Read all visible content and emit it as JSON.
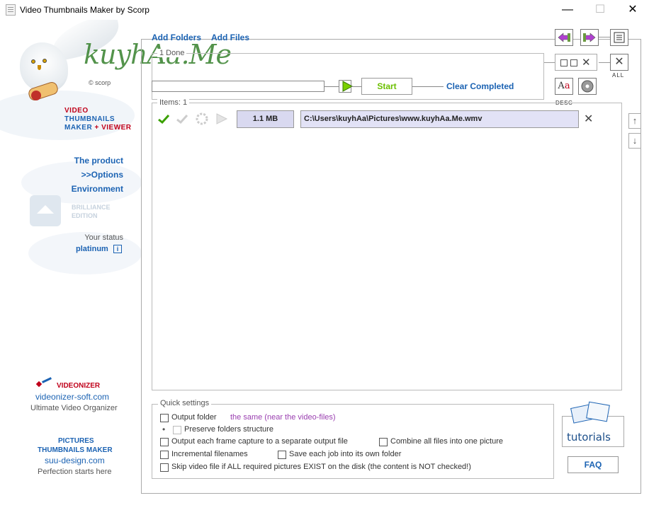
{
  "window": {
    "title": "Video Thumbnails Maker by Scorp",
    "minimize_glyph": "—",
    "maximize_glyph": "☐",
    "close_glyph": "✕"
  },
  "sidebar": {
    "scorp_label": "© scorp",
    "brand_video": "VIDEO",
    "brand_thumbnails": "THUMBNAILS",
    "brand_maker": "MAKER",
    "brand_plus": "+",
    "brand_viewer": "VIEWER",
    "nav": [
      {
        "label": "The product"
      },
      {
        "label": ">>Options"
      },
      {
        "label": "Environment"
      }
    ],
    "edition_line1": "BRILLIANCE",
    "edition_line2": "EDITION",
    "status_label": "Your status",
    "status_value": "platinum",
    "status_info_glyph": "i",
    "promo1_title": "VIDEONIZER",
    "promo1_site": "videonizer-soft.com",
    "promo1_tag": "Ultimate Video Organizer",
    "promo2_title1": "PICTURES",
    "promo2_title2": "THUMBNAILS MAKER",
    "promo2_site": "suu-design.com",
    "promo2_tag": "Perfection starts here"
  },
  "watermark": "kuyhAa.Me",
  "toolbar": {
    "add_folders": "Add Folders",
    "add_files": "Add Files",
    "all_label": "ALL",
    "desc_label": "DESC"
  },
  "progress_group": {
    "label": "1  Done",
    "start": "Start",
    "clear_completed": "Clear Completed"
  },
  "items_group": {
    "label": "Items: 1",
    "items": [
      {
        "size": "1.1 MB",
        "path": "C:\\Users\\kuyhAa\\Pictures\\www.kuyhAa.Me.wmv"
      }
    ],
    "remove_glyph": "✕"
  },
  "side_arrows": {
    "up": "↑",
    "down": "↓"
  },
  "quick_settings": {
    "label": "Quick settings",
    "output_folder": "Output folder",
    "output_folder_value": "the same (near the video-files)",
    "preserve_bullet": "•",
    "preserve_structure": "Preserve folders structure",
    "separate_file": "Output each frame capture to a separate output file",
    "combine_all": "Combine all files into one picture",
    "incremental": "Incremental filenames",
    "save_each_job": "Save each job into its own folder",
    "skip_video": "Skip video file if ALL required pictures EXIST on the disk (the content is NOT checked!)"
  },
  "help": {
    "tutorials": "tutorials",
    "faq": "FAQ"
  },
  "colors": {
    "link_blue": "#1c63b3",
    "brand_red": "#c0001a",
    "start_green": "#6bbf00",
    "option_purple": "#9a3fb0"
  }
}
